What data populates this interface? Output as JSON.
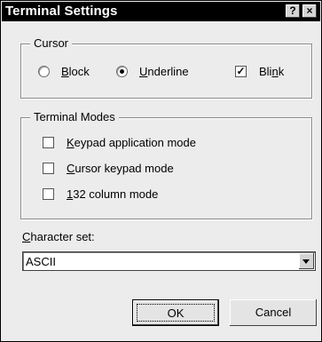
{
  "window": {
    "title": "Terminal Settings",
    "help_glyph": "?",
    "close_glyph": "×"
  },
  "cursor_group": {
    "legend": "Cursor",
    "options": [
      {
        "pre": "",
        "ul": "B",
        "post": "lock",
        "selected": false
      },
      {
        "pre": "",
        "ul": "U",
        "post": "nderline",
        "selected": true
      }
    ],
    "blink": {
      "pre": "Bli",
      "ul": "n",
      "post": "k",
      "checked": true,
      "mark": "✓"
    }
  },
  "modes_group": {
    "legend": "Terminal Modes",
    "items": [
      {
        "pre": "",
        "ul": "K",
        "post": "eypad application mode",
        "checked": false
      },
      {
        "pre": "",
        "ul": "C",
        "post": "ursor keypad mode",
        "checked": false
      },
      {
        "pre": "",
        "ul": "1",
        "post": "32 column mode",
        "checked": false
      }
    ]
  },
  "charset": {
    "label_pre": "",
    "label_ul": "C",
    "label_post": "haracter set:",
    "value": "ASCII"
  },
  "buttons": {
    "ok": "OK",
    "cancel": "Cancel"
  }
}
